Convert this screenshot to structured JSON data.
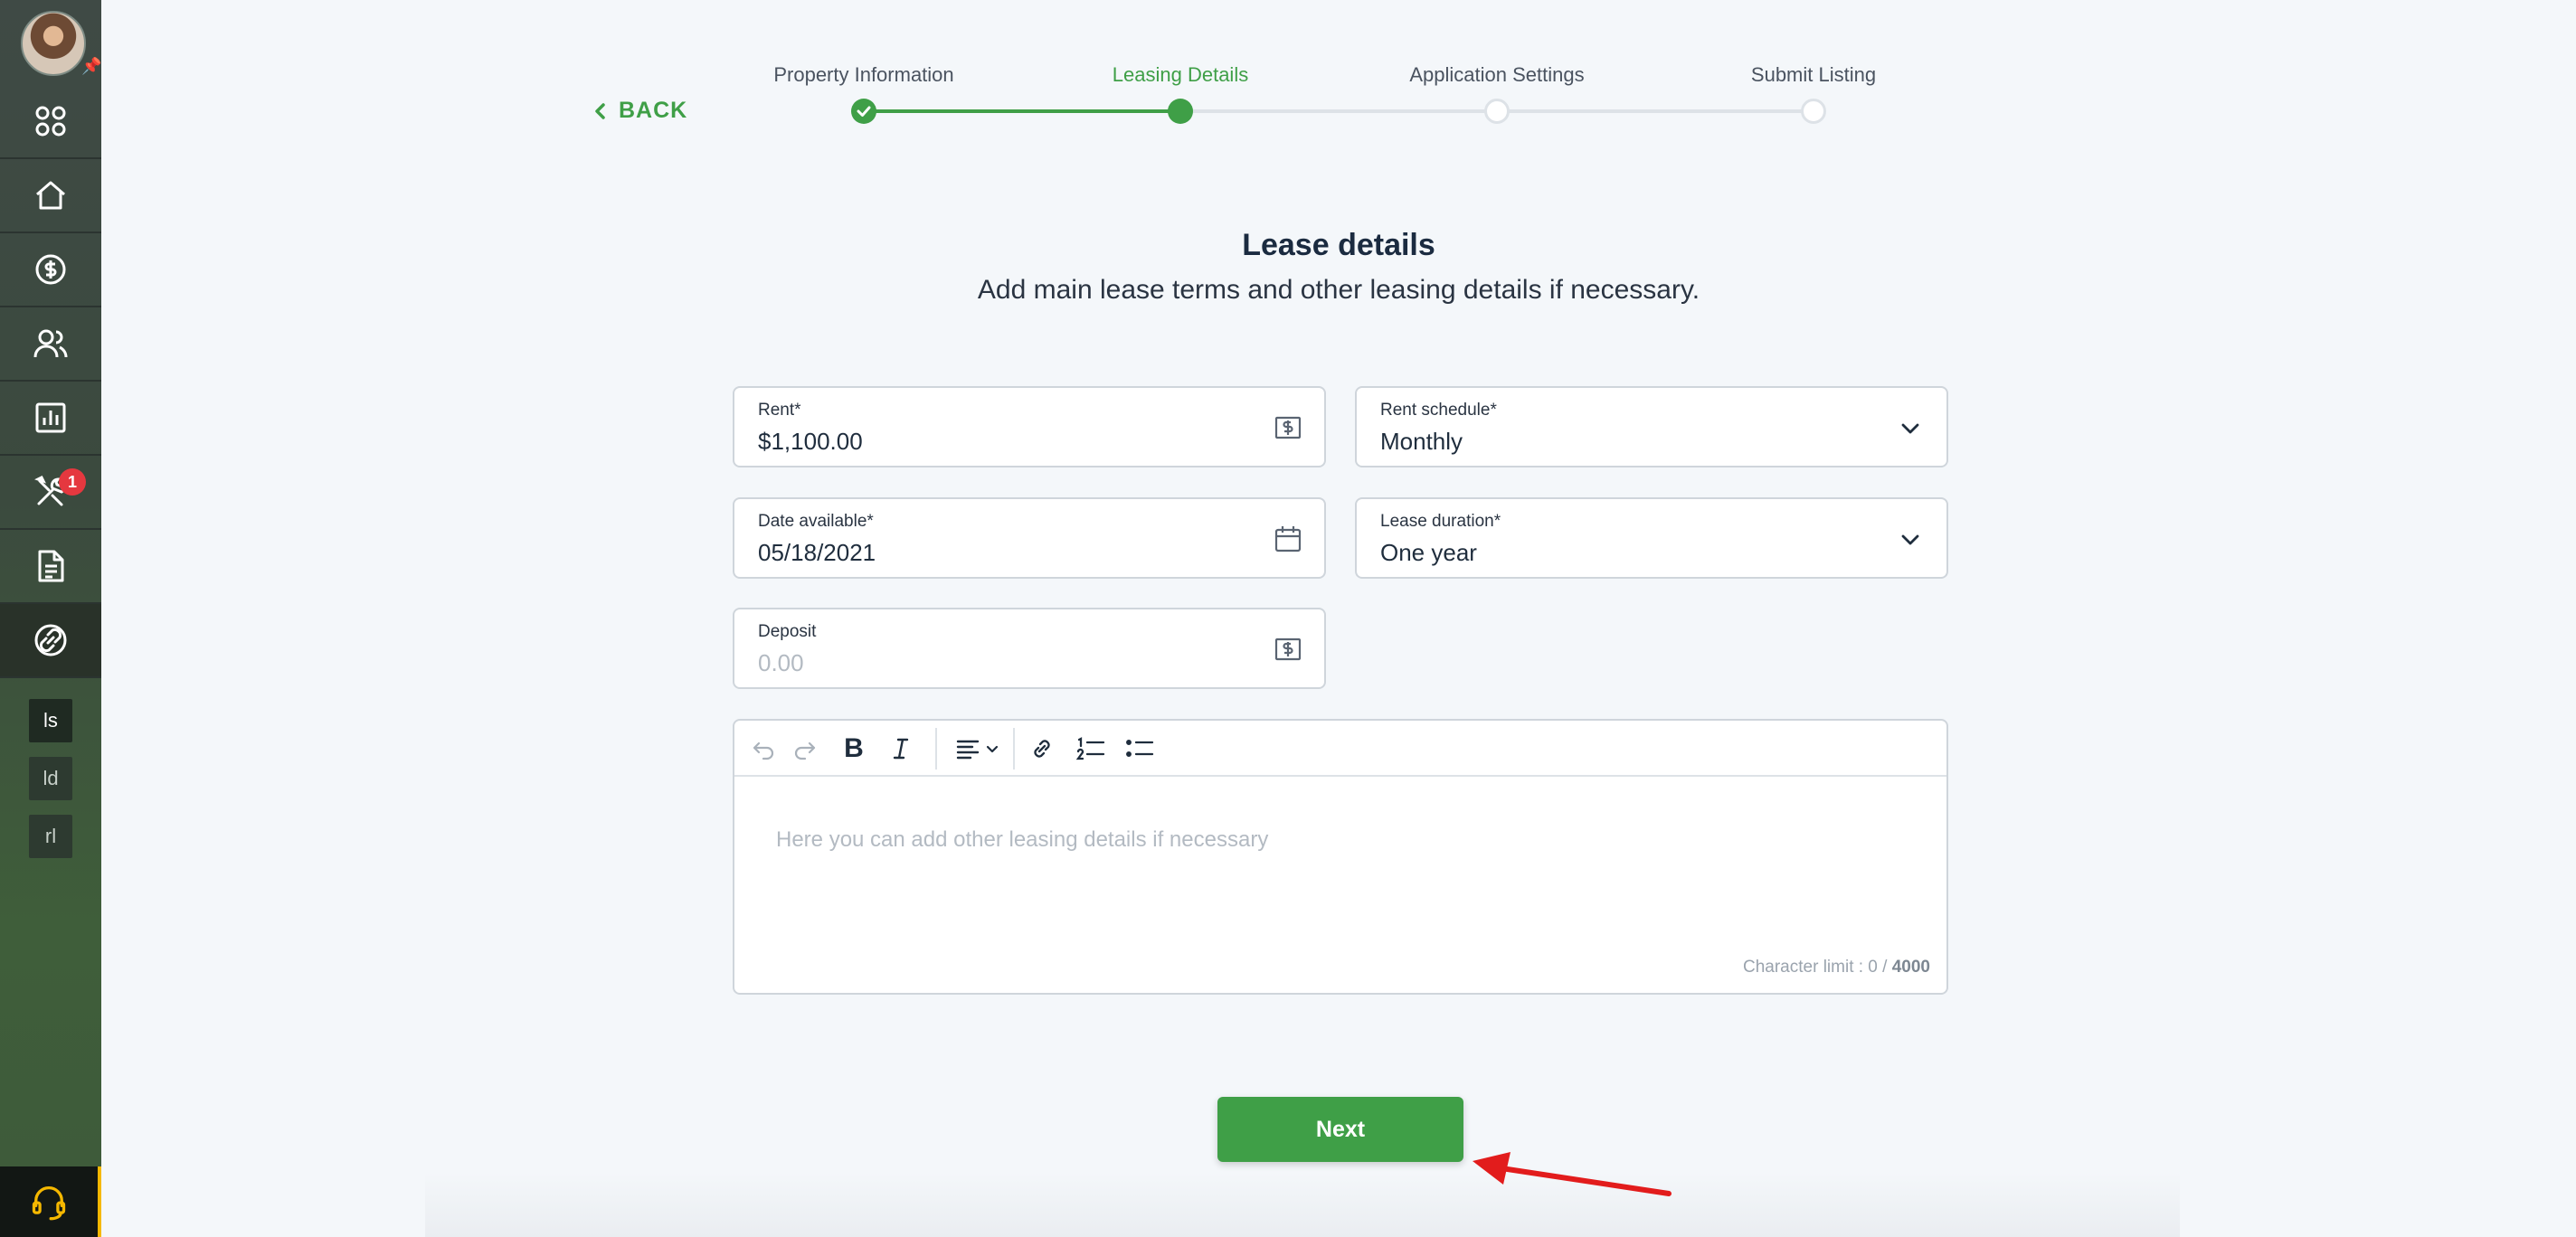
{
  "sidebar": {
    "nav": [
      {
        "icon": "dashboard-icon"
      },
      {
        "icon": "home-icon"
      },
      {
        "icon": "dollar-icon"
      },
      {
        "icon": "people-icon"
      },
      {
        "icon": "reports-icon"
      },
      {
        "icon": "tools-icon",
        "badge": "1"
      },
      {
        "icon": "document-icon"
      },
      {
        "icon": "link-icon"
      }
    ],
    "shortcuts": [
      "ls",
      "ld",
      "rl"
    ],
    "support_icon": "headset-icon",
    "colors": {
      "accent": "#3f9f47",
      "badge": "#e5383f",
      "support_edge": "#f5b800"
    }
  },
  "header": {
    "back_label": "BACK",
    "steps": [
      {
        "label": "Property Information",
        "state": "done"
      },
      {
        "label": "Leasing Details",
        "state": "current"
      },
      {
        "label": "Application Settings",
        "state": "todo"
      },
      {
        "label": "Submit Listing",
        "state": "todo"
      }
    ]
  },
  "main": {
    "title": "Lease details",
    "subtitle": "Add main lease terms and other leasing details if necessary.",
    "fields": {
      "rent": {
        "label": "Rent*",
        "value": "$1,100.00",
        "icon": "money-icon"
      },
      "rent_schedule": {
        "label": "Rent schedule*",
        "value": "Monthly",
        "icon": "chevron-down-icon"
      },
      "date_available": {
        "label": "Date available*",
        "value": "05/18/2021",
        "icon": "calendar-icon"
      },
      "lease_duration": {
        "label": "Lease duration*",
        "value": "One year",
        "icon": "chevron-down-icon"
      },
      "deposit": {
        "label": "Deposit",
        "placeholder": "0.00",
        "icon": "money-icon"
      }
    },
    "editor": {
      "placeholder": "Here you can add other leasing details if necessary",
      "counter_prefix": "Character limit : 0 / ",
      "counter_max": "4000",
      "toolbar": [
        "undo-icon",
        "redo-icon",
        "bold-icon",
        "italic-icon",
        "align-icon",
        "link-icon",
        "ordered-list-icon",
        "bullet-list-icon"
      ]
    },
    "next_label": "Next"
  }
}
